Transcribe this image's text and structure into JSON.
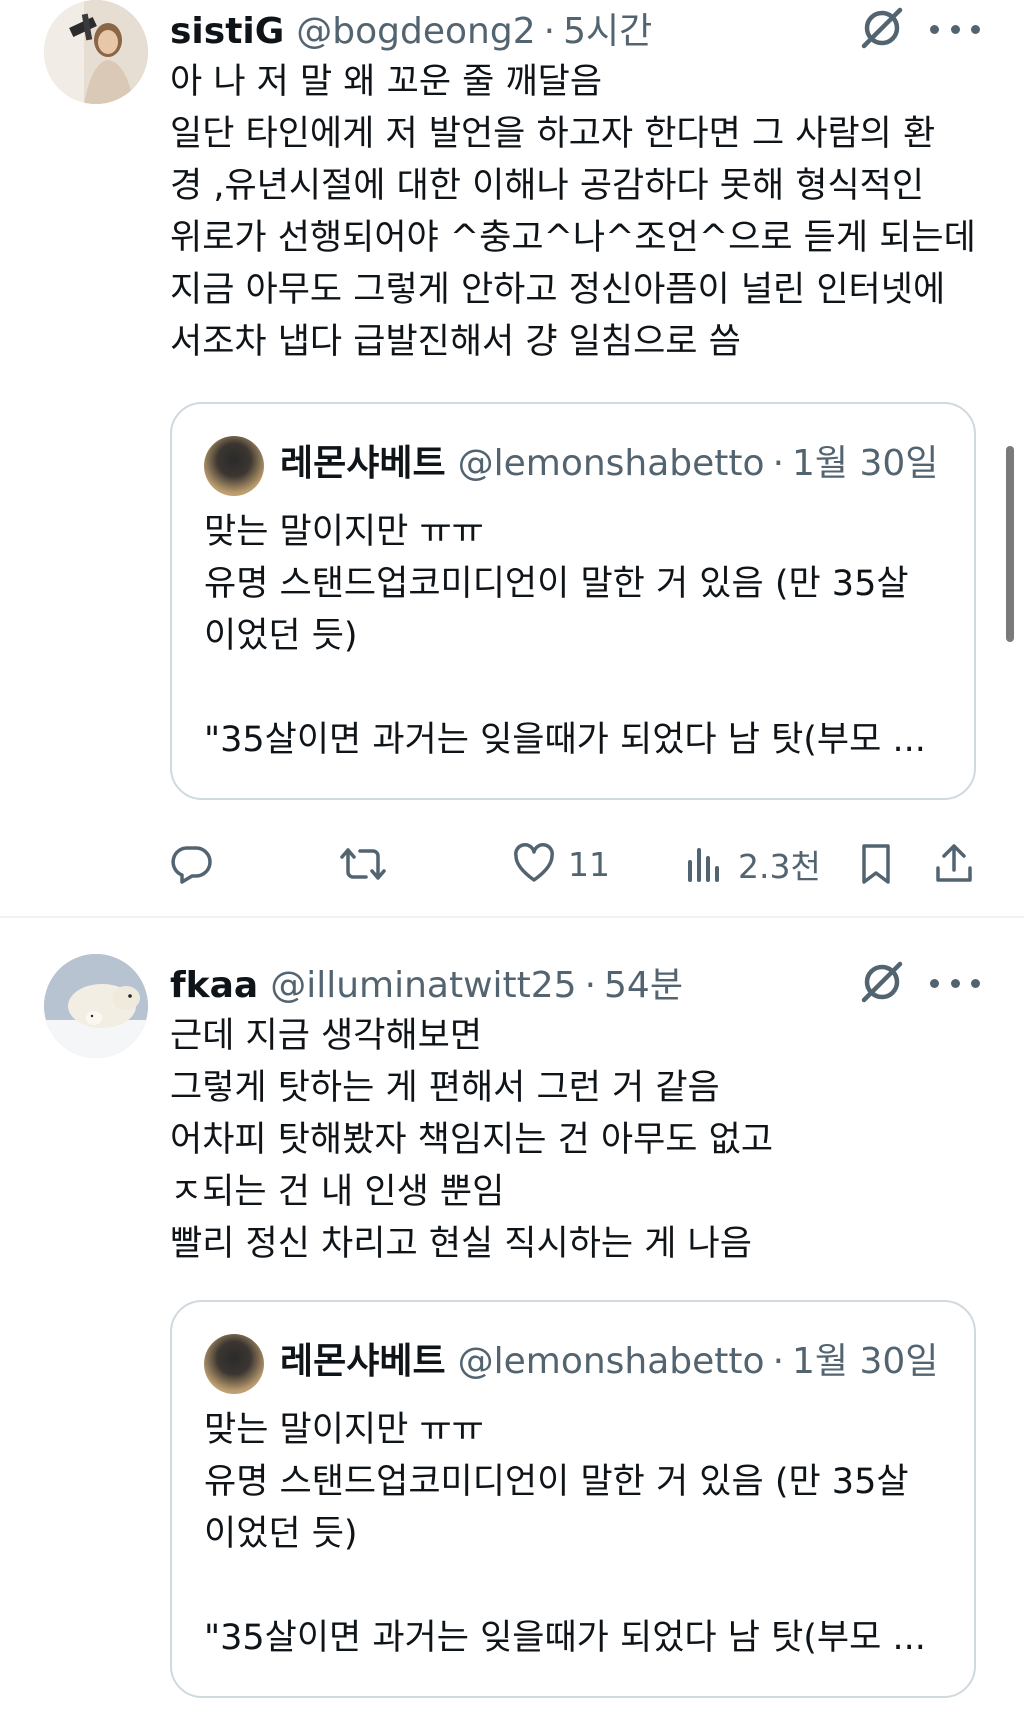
{
  "tweets": [
    {
      "author_name": "sistiG",
      "author_handle": "@bogdeong2",
      "separator": "·",
      "time": "5시간",
      "lines": [
        "아 나 저 말 왜 꼬운 줄 깨달음",
        "일단 타인에게 저 발언을 하고자 한다면 그 사람의 환",
        "경 ,유년시절에 대한 이해나 공감하다 못해 형식적인",
        "위로가 선행되어야 ^충고^나^조언^으로 듣게 되는데",
        "지금 아무도 그렇게 안하고 정신아픔이 널린 인터넷에",
        "서조차 냅다 급발진해서 걍 일침으로 씀"
      ],
      "quote": {
        "author_name": "레몬샤베트",
        "author_handle": "@lemonshabetto",
        "separator": "·",
        "time": "1월 30일",
        "lines": [
          "맞는 말이지만 ㅠㅠ",
          "유명 스탠드업코미디언이 말한 거 있음 (만 35살",
          "이었던 듯)",
          "",
          "\"35살이면 과거는 잊을때가 되었다 남 탓(부모 ..."
        ]
      },
      "actions": {
        "reply_count": "",
        "retweet_count": "",
        "like_count": "11",
        "views_count": "2.3천"
      }
    },
    {
      "author_name": "fkaa",
      "author_handle": "@illuminatwitt25",
      "separator": "·",
      "time": "54분",
      "lines": [
        "근데 지금 생각해보면",
        "그렇게 탓하는 게 편해서 그런 거 같음",
        "어차피 탓해봤자 책임지는 건 아무도 없고",
        "ㅈ되는 건 내 인생 뿐임",
        "빨리 정신 차리고 현실 직시하는 게 나음"
      ],
      "quote": {
        "author_name": "레몬샤베트",
        "author_handle": "@lemonshabetto",
        "separator": "·",
        "time": "1월 30일",
        "lines": [
          "맞는 말이지만 ㅠㅠ",
          "유명 스탠드업코미디언이 말한 거 있음 (만 35살",
          "이었던 듯)",
          "",
          "\"35살이면 과거는 잊을때가 되었다 남 탓(부모 ..."
        ]
      }
    }
  ],
  "icons": {
    "grok": "grok-icon",
    "more": "more-icon",
    "reply": "reply-icon",
    "retweet": "retweet-icon",
    "like": "heart-icon",
    "views": "views-icon",
    "bookmark": "bookmark-icon",
    "share": "share-icon"
  },
  "colors": {
    "text": "#0f1419",
    "secondary": "#536471",
    "border": "#cfd9de",
    "divider": "#eff3f4"
  }
}
